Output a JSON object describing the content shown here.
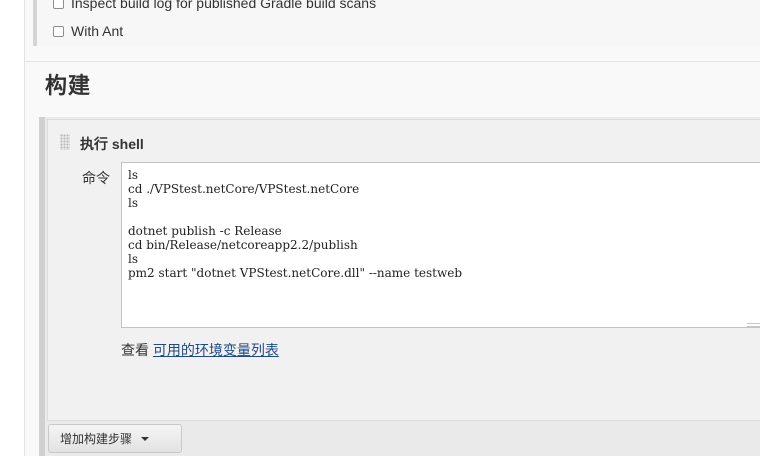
{
  "options": {
    "items": [
      {
        "label": "Inspect build log for published Gradle build scans",
        "checked": false
      },
      {
        "label": "With Ant",
        "checked": false
      }
    ]
  },
  "build_section": {
    "title": "构建"
  },
  "build_step": {
    "title": "执行 shell",
    "command_label": "命令",
    "command_value": "ls\ncd ./VPStest.netCore/VPStest.netCore\nls\n\ndotnet publish -c Release\ncd bin/Release/netcoreapp2.2/publish\nls\npm2 start \"dotnet VPStest.netCore.dll\" --name testweb",
    "env_prefix": "查看 ",
    "env_link": "可用的环境变量列表"
  },
  "add_step_button": {
    "label": "增加构建步骤"
  },
  "colors": {
    "link": "#204a87",
    "panel_bg": "#f9f9f9",
    "step_bg": "#f1f1f1"
  },
  "icons": {
    "drag_handle": "drag-handle-icon",
    "dropdown": "caret-down-icon"
  }
}
